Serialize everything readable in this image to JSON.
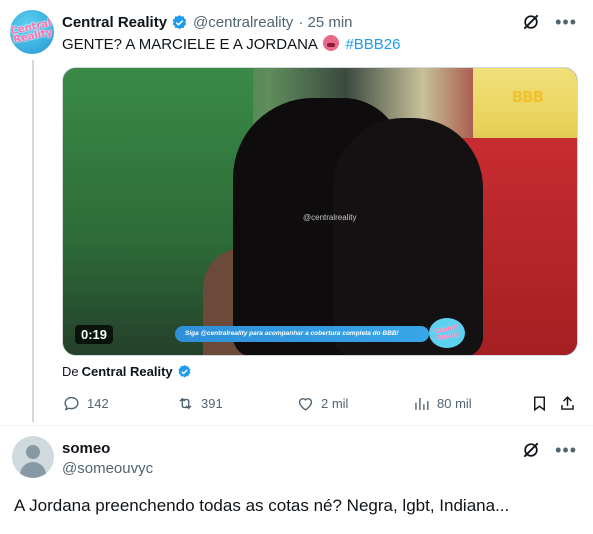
{
  "tweet": {
    "author_name": "Central Reality",
    "author_handle": "@centralreality",
    "timestamp": "· 25 min",
    "avatar_text": "Central Reality",
    "text_before": "GENTE? A MARCIELE E A JORDANA",
    "emoji": "pouting-face-emoji",
    "hashtag": "#BBB26",
    "video": {
      "duration": "0:19",
      "logo_text": "BBB",
      "watermark": "@centralreality",
      "banner_text": "Siga @centralreality para acompanhar a cobertura completa do BBB!",
      "banner_logo_text": "Central Reality"
    },
    "from_prefix": "De",
    "from_name": "Central Reality",
    "actions": {
      "replies": "142",
      "reposts": "391",
      "likes": "2 mil",
      "views": "80 mil"
    }
  },
  "reply": {
    "author_name": "someo",
    "author_handle": "@someouvyc",
    "text": "A Jordana preenchendo todas as cotas né? Negra, lgbt, Indiana..."
  },
  "colors": {
    "accent": "#1d9bf0",
    "muted": "#536471",
    "text": "#0f1419"
  }
}
